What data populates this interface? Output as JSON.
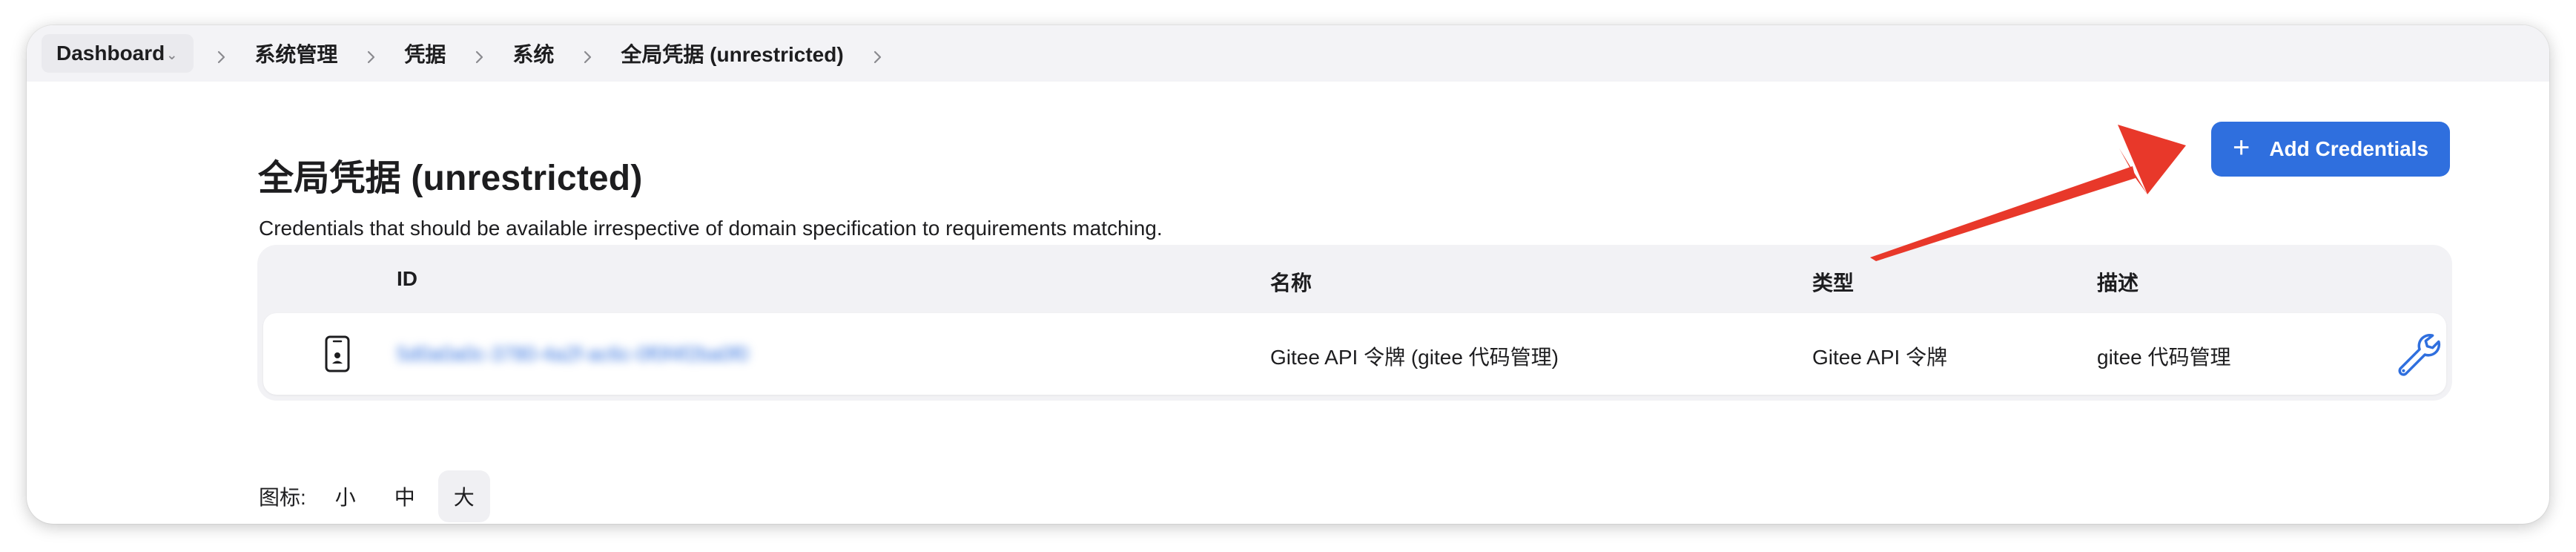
{
  "breadcrumb": {
    "items": [
      "Dashboard",
      "系统管理",
      "凭据",
      "系统",
      "全局凭据 (unrestricted)"
    ],
    "dropdown_glyph": "⌄"
  },
  "page": {
    "title": "全局凭据 (unrestricted)",
    "description": "Credentials that should be available irrespective of domain specification to requirements matching."
  },
  "add_button": {
    "label": "Add Credentials",
    "icon": "plus-icon"
  },
  "table": {
    "columns": [
      "ID",
      "名称",
      "类型",
      "描述"
    ],
    "rows": [
      {
        "icon": "mobile-credential-icon",
        "id": "5d0a0a0c-3780-4a2f-ac6c-0f0f4f2ba0f0",
        "name": "Gitee API 令牌 (gitee 代码管理)",
        "type": "Gitee API 令牌",
        "description": "gitee 代码管理",
        "action_icon": "wrench-icon"
      }
    ]
  },
  "icon_size": {
    "label": "图标:",
    "options": [
      "小",
      "中",
      "大"
    ],
    "selected": "大"
  },
  "colors": {
    "accent": "#2f6fde",
    "annotation_arrow": "#e8382a"
  }
}
